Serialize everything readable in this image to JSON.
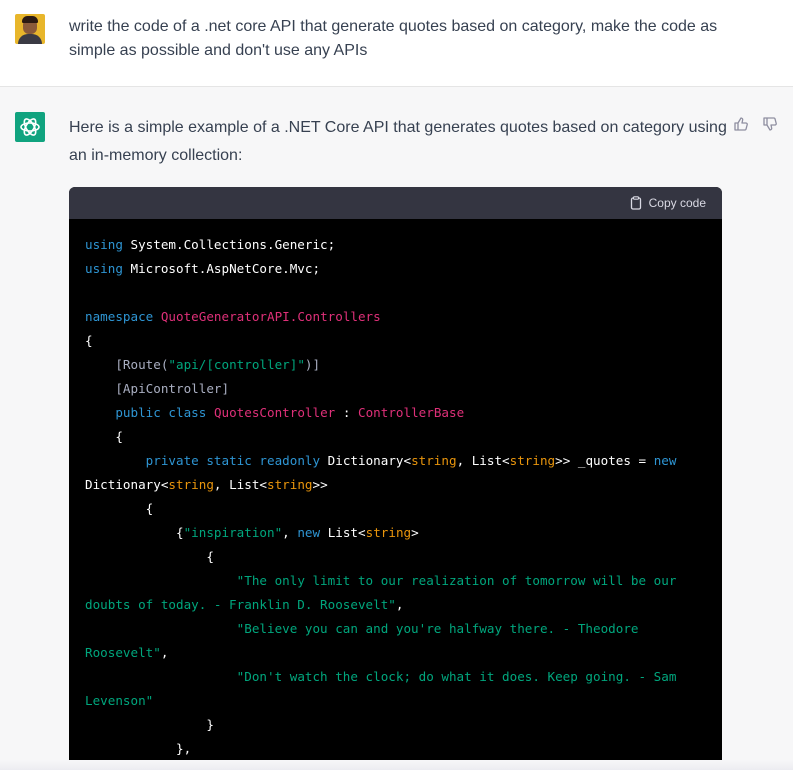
{
  "user": {
    "message": "write the code of a .net core API that generate quotes based on category, make the code as simple as possible and don't use any APIs"
  },
  "assistant": {
    "intro": "Here is a simple example of a .NET Core API that generates quotes based on category using an in-memory collection:"
  },
  "code_block": {
    "copy_label": "Copy code",
    "tokens": {
      "using": "using",
      "sys_generic": " System.Collections.Generic;",
      "aspnet_mvc": " Microsoft.AspNetCore.Mvc;",
      "namespace_kw": "namespace",
      "namespace_name": "QuoteGeneratorAPI.Controllers",
      "brace_open": "{",
      "brace_close": "}",
      "route_open": "[Route(",
      "route_value": "\"api/[controller]\"",
      "route_close": ")]",
      "api_controller": "[ApiController]",
      "public_class": "public class",
      "class_name": "QuotesController",
      "colon": " : ",
      "base_class": "ControllerBase",
      "private_static_readonly": "private static readonly",
      "dictionary": "Dictionary<",
      "string": "string",
      "comma_list": ", List<",
      "gtgt": ">>",
      "quotes_field": " _quotes = ",
      "new_kw": "new",
      "dictionary2": "Dictionary<",
      "open_obj": "{",
      "inspiration": "\"inspiration\"",
      "comma": ", ",
      "list_open": "List<",
      "gt": ">",
      "quote1a": "\"The only limit to our realization of tomorrow will be our",
      "quote1b": "doubts of today. - Franklin D. Roosevelt\"",
      "quote2a": "\"Believe you can and you're halfway there. - Theodore",
      "quote2b": "Roosevelt\"",
      "quote3a": "\"Don't watch the clock; do what it does. Keep going. - Sam",
      "quote3b": "Levenson\"",
      "close_comma": "},",
      "punct_comma": ","
    }
  },
  "colors": {
    "keyword": "#2e95d3",
    "type": "#df3079",
    "string": "#00a67d",
    "generic_type": "#e9950c",
    "brand": "#10a37f"
  },
  "icons": {
    "bot_avatar": "openai-logo-icon",
    "copy": "clipboard-icon",
    "thumbs_up": "thumbs-up-icon",
    "thumbs_down": "thumbs-down-icon"
  }
}
